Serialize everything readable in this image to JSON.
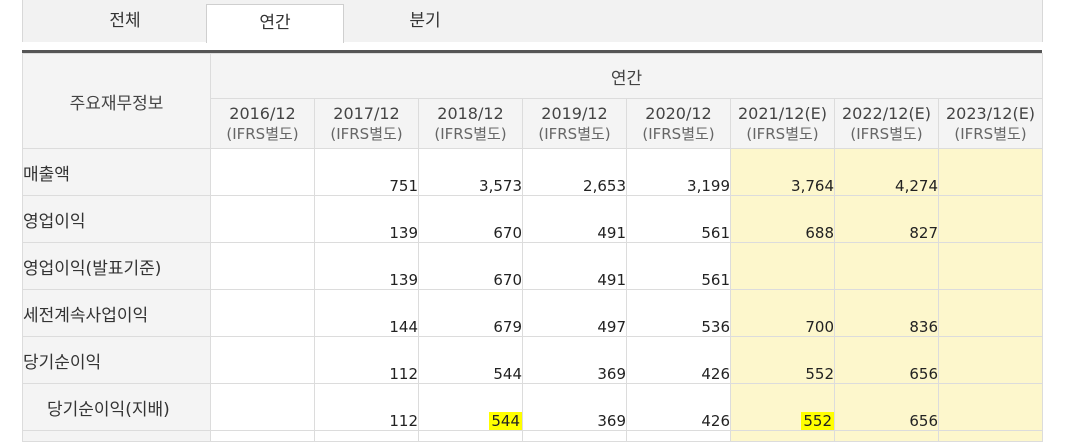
{
  "tabs": [
    {
      "label": "전체",
      "active": false
    },
    {
      "label": "연간",
      "active": true
    },
    {
      "label": "분기",
      "active": false
    }
  ],
  "table": {
    "corner_label": "주요재무정보",
    "group_label": "연간",
    "columns": [
      {
        "period": "2016/12",
        "basis": "(IFRS별도)",
        "estimate": false
      },
      {
        "period": "2017/12",
        "basis": "(IFRS별도)",
        "estimate": false
      },
      {
        "period": "2018/12",
        "basis": "(IFRS별도)",
        "estimate": false
      },
      {
        "period": "2019/12",
        "basis": "(IFRS별도)",
        "estimate": false
      },
      {
        "period": "2020/12",
        "basis": "(IFRS별도)",
        "estimate": false
      },
      {
        "period": "2021/12(E)",
        "basis": "(IFRS별도)",
        "estimate": true
      },
      {
        "period": "2022/12(E)",
        "basis": "(IFRS별도)",
        "estimate": true
      },
      {
        "period": "2023/12(E)",
        "basis": "(IFRS별도)",
        "estimate": true
      }
    ],
    "rows": [
      {
        "label": "매출액",
        "values": [
          "",
          "751",
          "3,573",
          "2,653",
          "3,199",
          "3,764",
          "4,274",
          ""
        ]
      },
      {
        "label": "영업이익",
        "values": [
          "",
          "139",
          "670",
          "491",
          "561",
          "688",
          "827",
          ""
        ]
      },
      {
        "label": "영업이익(발표기준)",
        "values": [
          "",
          "139",
          "670",
          "491",
          "561",
          "",
          "",
          ""
        ]
      },
      {
        "label": "세전계속사업이익",
        "values": [
          "",
          "144",
          "679",
          "497",
          "536",
          "700",
          "836",
          ""
        ]
      },
      {
        "label": "당기순이익",
        "values": [
          "",
          "112",
          "544",
          "369",
          "426",
          "552",
          "656",
          ""
        ]
      },
      {
        "label": "당기순이익(지배)",
        "values": [
          "",
          "112",
          "544",
          "369",
          "426",
          "552",
          "656",
          ""
        ]
      }
    ]
  },
  "colors": {
    "estimate_bg": "#fdf7cc",
    "header_bg": "#f4f4f4",
    "highlight": "#ffff00"
  }
}
